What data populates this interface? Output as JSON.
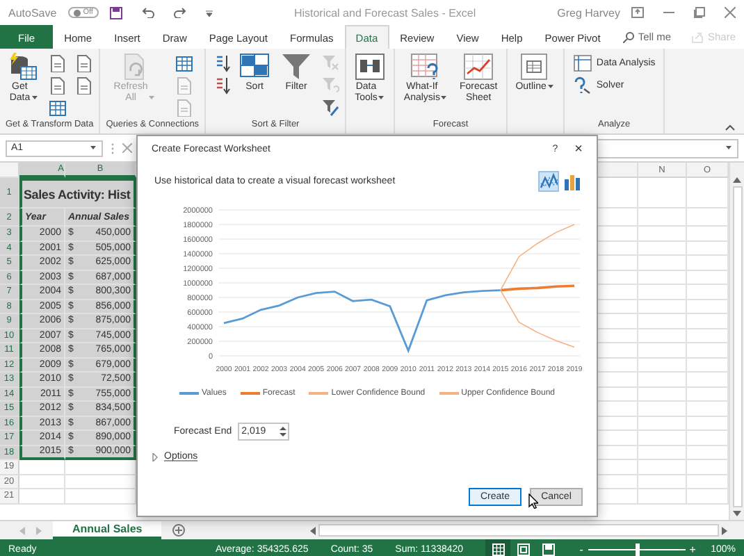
{
  "title_bar": {
    "autosave": "AutoSave",
    "autosave_toggle": {
      "label": "Off",
      "on": false
    },
    "title": "Historical and Forecast Sales  -  Excel",
    "user": "Greg Harvey"
  },
  "ribbon_tabs": [
    {
      "label": "File",
      "kind": "file",
      "selected": false
    },
    {
      "label": "Home",
      "kind": "tab",
      "selected": false
    },
    {
      "label": "Insert",
      "kind": "tab",
      "selected": false
    },
    {
      "label": "Draw",
      "kind": "tab",
      "selected": false
    },
    {
      "label": "Page Layout",
      "kind": "tab",
      "selected": false
    },
    {
      "label": "Formulas",
      "kind": "tab",
      "selected": false
    },
    {
      "label": "Data",
      "kind": "tab",
      "selected": true
    },
    {
      "label": "Review",
      "kind": "tab",
      "selected": false
    },
    {
      "label": "View",
      "kind": "tab",
      "selected": false
    },
    {
      "label": "Help",
      "kind": "tab",
      "selected": false
    },
    {
      "label": "Power Pivot",
      "kind": "tab",
      "selected": false
    }
  ],
  "tell_me": {
    "label": "Tell me"
  },
  "share": {
    "label": "Share",
    "disabled": true
  },
  "ribbon_groups": [
    {
      "label": "Get & Transform Data",
      "buttons": [
        {
          "kind": "large",
          "label": "Get Data",
          "dropdown": true,
          "disabled": false
        },
        {
          "kind": "icon",
          "disabled": false
        },
        {
          "kind": "icon",
          "disabled": false
        },
        {
          "kind": "icon",
          "disabled": false
        },
        {
          "kind": "icon",
          "disabled": false
        },
        {
          "kind": "icon",
          "disabled": false
        }
      ]
    },
    {
      "label": "Queries & Connections",
      "buttons": [
        {
          "kind": "large",
          "label": "Refresh All",
          "dropdown": true,
          "disabled": true
        },
        {
          "kind": "icon",
          "disabled": false
        },
        {
          "kind": "icon",
          "disabled": true
        },
        {
          "kind": "icon",
          "disabled": true
        }
      ]
    },
    {
      "label": "Sort & Filter",
      "buttons": [
        {
          "kind": "icon",
          "disabled": false
        },
        {
          "kind": "icon",
          "disabled": false
        },
        {
          "kind": "large",
          "label": "Sort",
          "dropdown": false,
          "disabled": false
        },
        {
          "kind": "large",
          "label": "Filter",
          "dropdown": false,
          "disabled": false
        },
        {
          "kind": "icon",
          "disabled": true
        },
        {
          "kind": "icon",
          "disabled": true
        },
        {
          "kind": "icon",
          "disabled": false
        }
      ]
    },
    {
      "buttons": [
        {
          "kind": "large",
          "label": "Data Tools",
          "dropdown": true,
          "disabled": false
        }
      ]
    },
    {
      "label": "Forecast",
      "buttons": [
        {
          "kind": "large",
          "label": "What-If Analysis",
          "dropdown": true,
          "disabled": false
        },
        {
          "kind": "large",
          "label": "Forecast Sheet",
          "dropdown": false,
          "disabled": false
        }
      ]
    },
    {
      "buttons": [
        {
          "kind": "large",
          "label": "Outline",
          "dropdown": true,
          "disabled": false
        }
      ]
    },
    {
      "label": "Analyze",
      "buttons": [
        {
          "kind": "small",
          "label": "Data Analysis",
          "disabled": false
        },
        {
          "kind": "small",
          "label": "Solver",
          "disabled": false
        }
      ]
    }
  ],
  "name_box": "A1",
  "sheet": {
    "columns": [
      {
        "label": "A",
        "selected": true
      },
      {
        "label": "B",
        "selected": true
      },
      {
        "label": "N",
        "selected": false
      },
      {
        "label": "O",
        "selected": false
      }
    ],
    "rows": [
      {
        "header": "1",
        "kind": "title",
        "selected": true,
        "title": "Sales Activity: Hist"
      },
      {
        "header": "2",
        "kind": "heading",
        "selected": true,
        "year": "Year",
        "amount": "Annual Sales"
      },
      {
        "header": "3",
        "kind": "data",
        "selected": true,
        "year": "2000",
        "currency": "$",
        "amount": "450,000"
      },
      {
        "header": "4",
        "kind": "data",
        "selected": true,
        "year": "2001",
        "currency": "$",
        "amount": "505,000"
      },
      {
        "header": "5",
        "kind": "data",
        "selected": true,
        "year": "2002",
        "currency": "$",
        "amount": "625,000"
      },
      {
        "header": "6",
        "kind": "data",
        "selected": true,
        "year": "2003",
        "currency": "$",
        "amount": "687,000"
      },
      {
        "header": "7",
        "kind": "data",
        "selected": true,
        "year": "2004",
        "currency": "$",
        "amount": "800,300"
      },
      {
        "header": "8",
        "kind": "data",
        "selected": true,
        "year": "2005",
        "currency": "$",
        "amount": "856,000"
      },
      {
        "header": "9",
        "kind": "data",
        "selected": true,
        "year": "2006",
        "currency": "$",
        "amount": "875,000"
      },
      {
        "header": "10",
        "kind": "data",
        "selected": true,
        "year": "2007",
        "currency": "$",
        "amount": "745,000"
      },
      {
        "header": "11",
        "kind": "data",
        "selected": true,
        "year": "2008",
        "currency": "$",
        "amount": "765,000"
      },
      {
        "header": "12",
        "kind": "data",
        "selected": true,
        "year": "2009",
        "currency": "$",
        "amount": "679,000"
      },
      {
        "header": "13",
        "kind": "data",
        "selected": true,
        "year": "2010",
        "currency": "$",
        "amount": "72,500"
      },
      {
        "header": "14",
        "kind": "data",
        "selected": true,
        "year": "2011",
        "currency": "$",
        "amount": "755,000"
      },
      {
        "header": "15",
        "kind": "data",
        "selected": true,
        "year": "2012",
        "currency": "$",
        "amount": "834,500"
      },
      {
        "header": "16",
        "kind": "data",
        "selected": true,
        "year": "2013",
        "currency": "$",
        "amount": "867,000"
      },
      {
        "header": "17",
        "kind": "data",
        "selected": true,
        "year": "2014",
        "currency": "$",
        "amount": "890,000"
      },
      {
        "header": "18",
        "kind": "data",
        "selected": true,
        "year": "2015",
        "currency": "$",
        "amount": "900,000"
      },
      {
        "header": "19",
        "kind": "empty",
        "selected": false
      },
      {
        "header": "20",
        "kind": "empty",
        "selected": false
      },
      {
        "header": "21",
        "kind": "empty",
        "selected": false
      }
    ]
  },
  "dialog": {
    "title": "Create Forecast Worksheet",
    "help": "?",
    "close": "×",
    "description": "Use historical data to create a visual forecast worksheet",
    "chart_types": [
      {
        "kind": "line",
        "selected": true
      },
      {
        "kind": "column",
        "selected": false
      }
    ],
    "chart_data": {
      "type": "line",
      "categories": [
        "2000",
        "2001",
        "2002",
        "2003",
        "2004",
        "2005",
        "2006",
        "2007",
        "2008",
        "2009",
        "2010",
        "2011",
        "2012",
        "2013",
        "2014",
        "2015",
        "2016",
        "2017",
        "2018",
        "2019"
      ],
      "series": [
        {
          "name": "Values",
          "color": "#5b9bd5",
          "values": [
            450000,
            510000,
            630000,
            690000,
            800000,
            860000,
            880000,
            750000,
            770000,
            680000,
            70000,
            760000,
            830000,
            870000,
            890000,
            900000,
            null,
            null,
            null,
            null
          ]
        },
        {
          "name": "Forecast",
          "color": "#ed7d31",
          "values": [
            null,
            null,
            null,
            null,
            null,
            null,
            null,
            null,
            null,
            null,
            null,
            null,
            null,
            null,
            null,
            900000,
            920000,
            930000,
            950000,
            960000
          ]
        },
        {
          "name": "Lower Confidence Bound",
          "color": "#f4b183",
          "values": [
            null,
            null,
            null,
            null,
            null,
            null,
            null,
            null,
            null,
            null,
            null,
            null,
            null,
            null,
            null,
            900000,
            460000,
            320000,
            210000,
            120000
          ]
        },
        {
          "name": "Upper Confidence Bound",
          "color": "#f4b183",
          "values": [
            null,
            null,
            null,
            null,
            null,
            null,
            null,
            null,
            null,
            null,
            null,
            null,
            null,
            null,
            null,
            900000,
            1360000,
            1540000,
            1690000,
            1800000
          ]
        }
      ],
      "grid": true,
      "legend": "bottom",
      "ylim": [
        0,
        2000000
      ],
      "yticks": [
        0,
        200000,
        400000,
        600000,
        800000,
        1000000,
        1200000,
        1400000,
        1600000,
        1800000,
        2000000
      ]
    },
    "forecast_end": {
      "label": "Forecast End",
      "value": "2,019"
    },
    "options": {
      "label": "Options",
      "expanded": false
    },
    "buttons": [
      {
        "label": "Create",
        "kind": "default"
      },
      {
        "label": "Cancel",
        "kind": "normal"
      }
    ]
  },
  "sheet_tabs": [
    {
      "label": "Annual Sales",
      "selected": true
    }
  ],
  "status_bar": {
    "status": "Ready",
    "average": "Average: 354325.625",
    "count": "Count: 35",
    "sum": "Sum: 11338420",
    "views": [
      {
        "kind": "normal",
        "selected": true
      },
      {
        "kind": "page_layout",
        "selected": false
      },
      {
        "kind": "page_break",
        "selected": false
      }
    ],
    "zoom_out": "-",
    "zoom_in": "+",
    "zoom": {
      "level": 0.5,
      "reading": "100%"
    }
  }
}
